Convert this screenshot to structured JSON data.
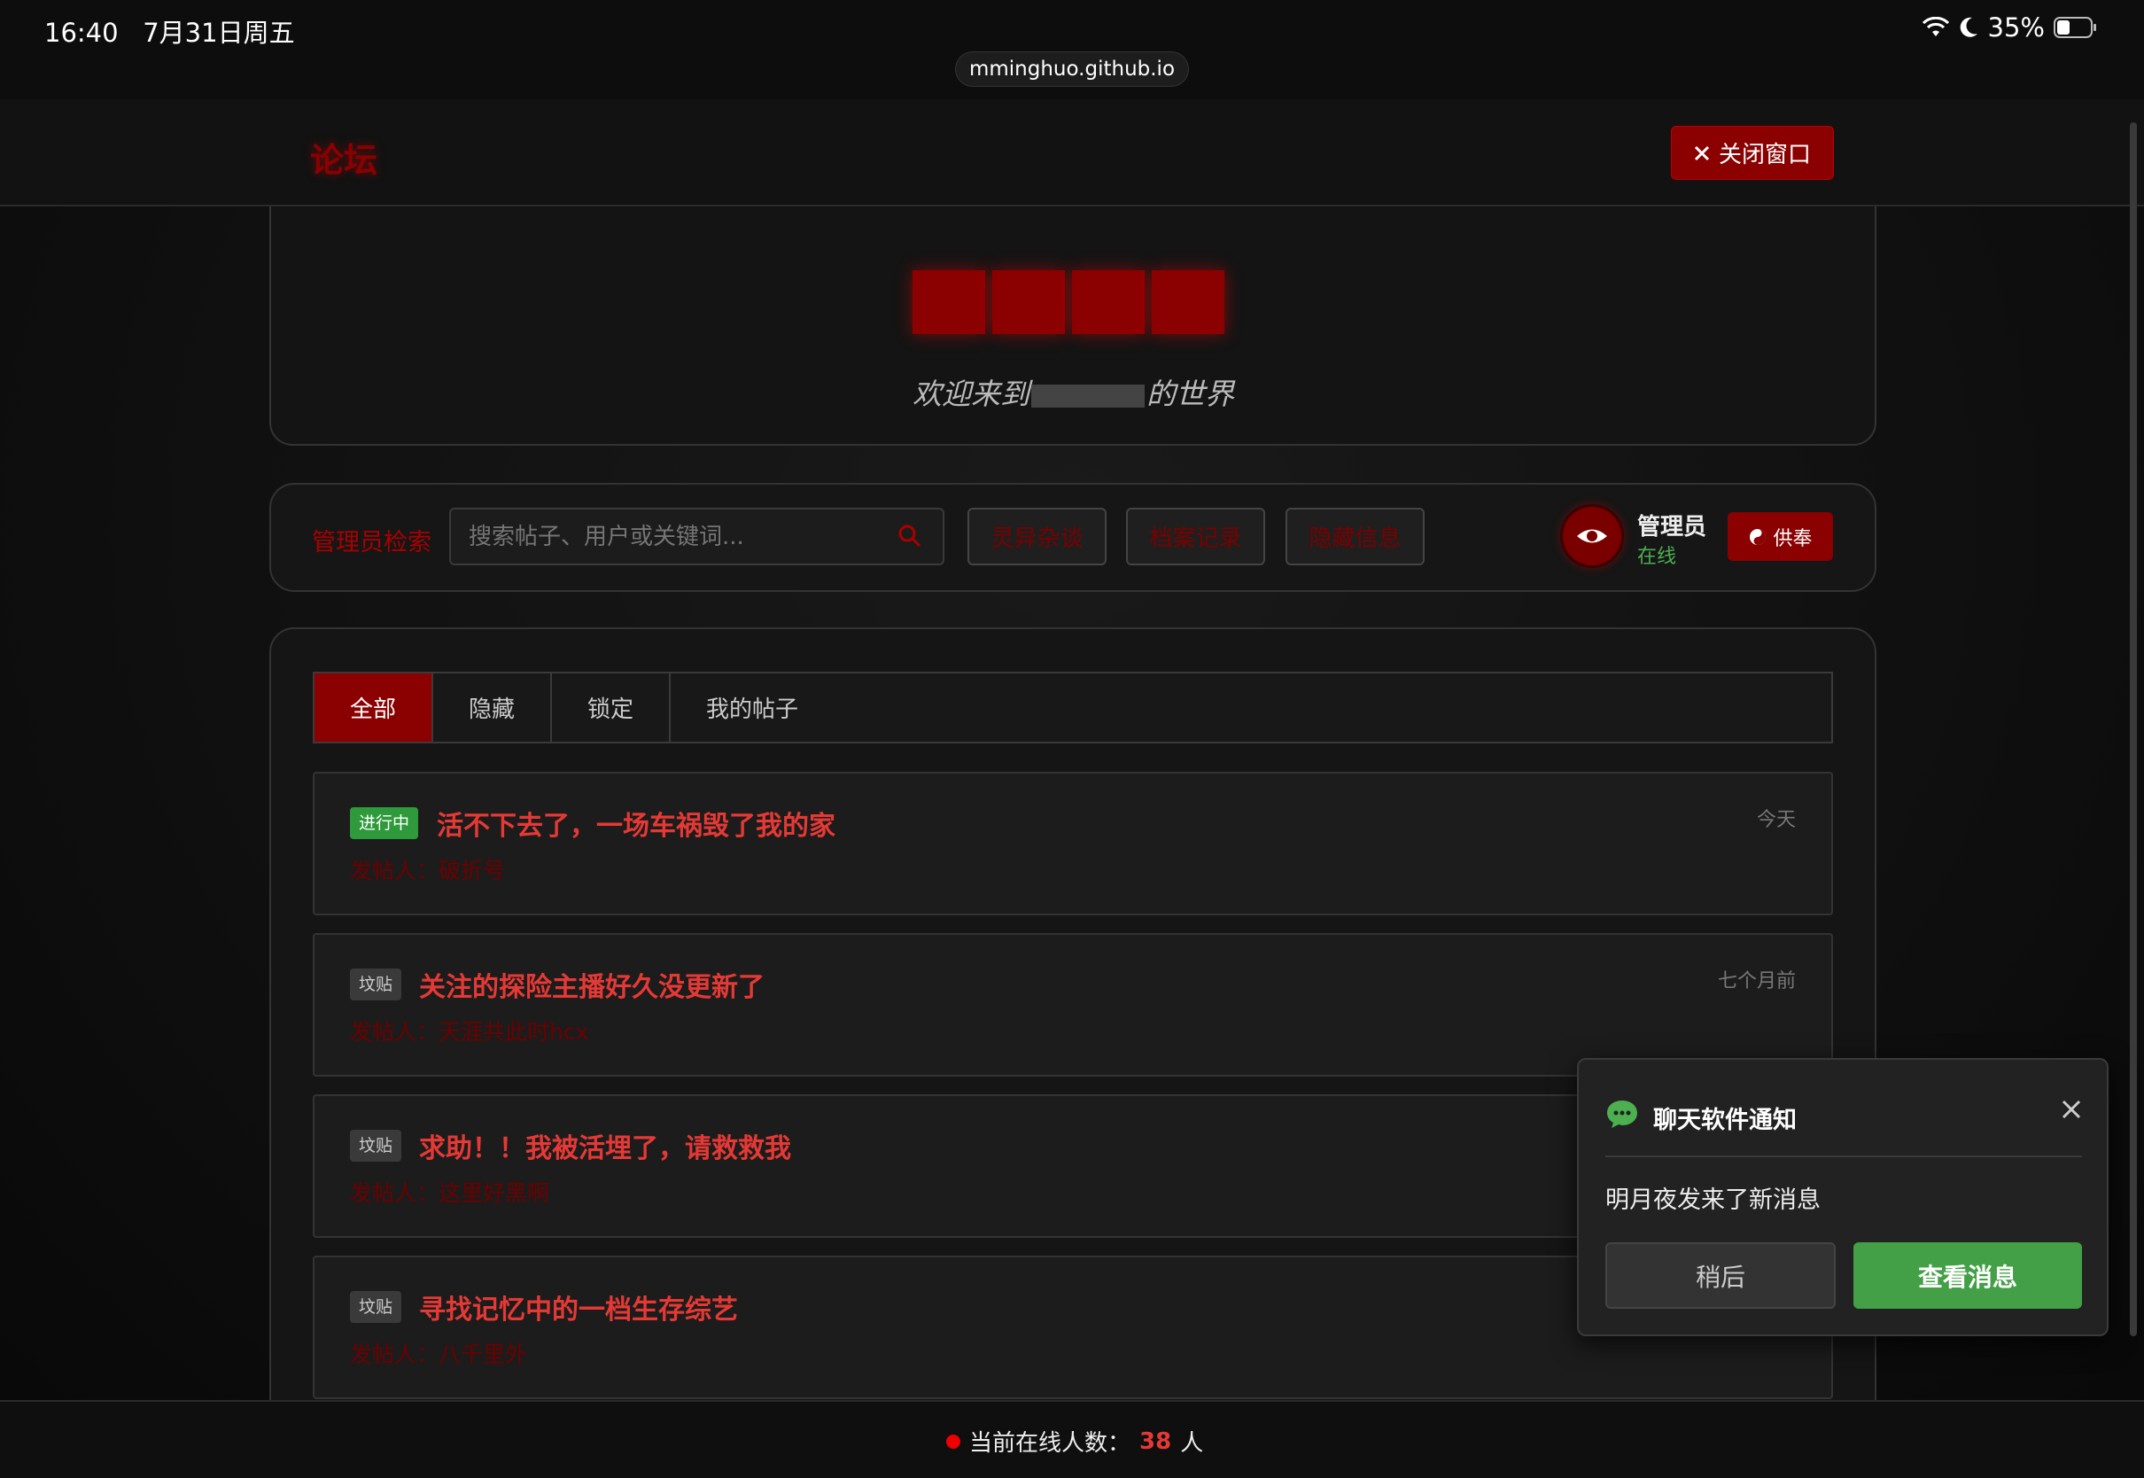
{
  "status_bar": {
    "time": "16:40",
    "date": "7月31日周五",
    "battery": "35%",
    "url": "mminghuo.github.io"
  },
  "nav": {
    "title": "论坛",
    "close_label": "关闭窗口"
  },
  "hero": {
    "subtitle_prefix": "欢迎来到",
    "subtitle_suffix": "的世界"
  },
  "search": {
    "label": "管理员检索",
    "placeholder": "搜索帖子、用户或关键词...",
    "categories": [
      "灵异杂谈",
      "档案记录",
      "隐藏信息"
    ]
  },
  "admin": {
    "name": "管理员",
    "status": "在线",
    "offer_label": "供奉"
  },
  "tabs": [
    "全部",
    "隐藏",
    "锁定",
    "我的帖子"
  ],
  "posts": [
    {
      "badge": "进行中",
      "title": "活不下去了，一场车祸毁了我的家",
      "author": "发帖人：破折号",
      "time": "今天"
    },
    {
      "badge": "坟贴",
      "title": "关注的探险主播好久没更新了",
      "author": "发帖人：天涯共此时hcx",
      "time": "七个月前"
    },
    {
      "badge": "坟贴",
      "title": "求助！！我被活埋了，请救救我",
      "author": "发帖人：这里好黑啊",
      "time": ""
    },
    {
      "badge": "坟贴",
      "title": "寻找记忆中的一档生存综艺",
      "author": "发帖人：八千里外",
      "time": ""
    }
  ],
  "notification": {
    "title": "聊天软件通知",
    "message": "明月夜发来了新消息",
    "later_label": "稍后",
    "view_label": "查看消息"
  },
  "footer": {
    "prefix": "当前在线人数：",
    "count": "38",
    "suffix": "人"
  },
  "colors": {
    "accent": "#8b0000",
    "title_red": "#e53935",
    "online_green": "#4caf50",
    "button_green": "#43a047"
  }
}
